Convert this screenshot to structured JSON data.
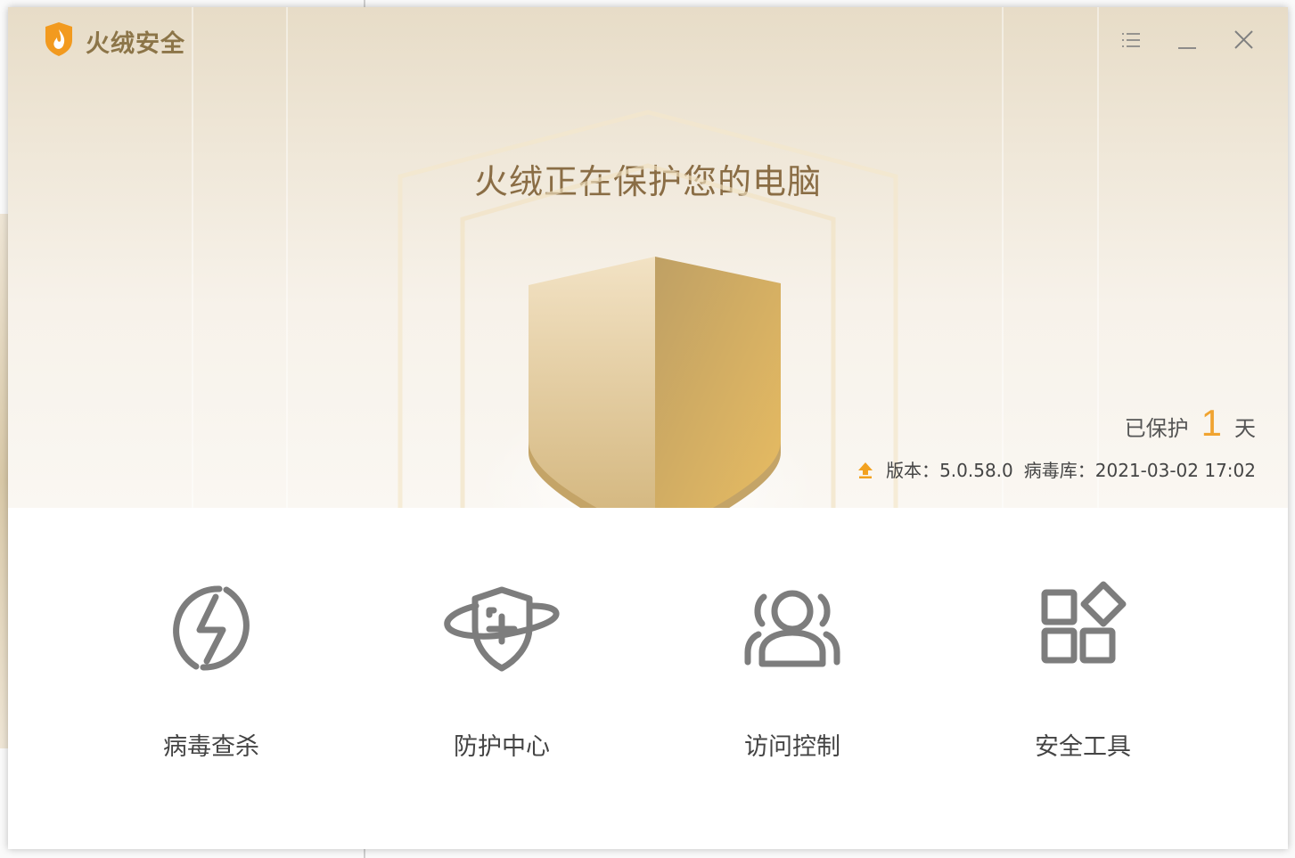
{
  "app": {
    "title": "火绒安全"
  },
  "status": {
    "headline": "火绒正在保护您的电脑",
    "protected_prefix": "已保护",
    "protected_days": "1",
    "protected_suffix": "天",
    "version_label": "版本：",
    "version": "5.0.58.0",
    "virusdb_label": "病毒库：",
    "virusdb_date": "2021-03-02 17:02"
  },
  "features": [
    {
      "label": "病毒查杀",
      "icon": "lightning-circle-icon"
    },
    {
      "label": "防护中心",
      "icon": "shield-plus-orbit-icon"
    },
    {
      "label": "访问控制",
      "icon": "users-icon"
    },
    {
      "label": "安全工具",
      "icon": "grid-tools-icon"
    }
  ],
  "colors": {
    "brand": "#8c7548",
    "accent": "#f0a330",
    "shield_left": "#e3cca2",
    "shield_right": "#d7b36a"
  }
}
